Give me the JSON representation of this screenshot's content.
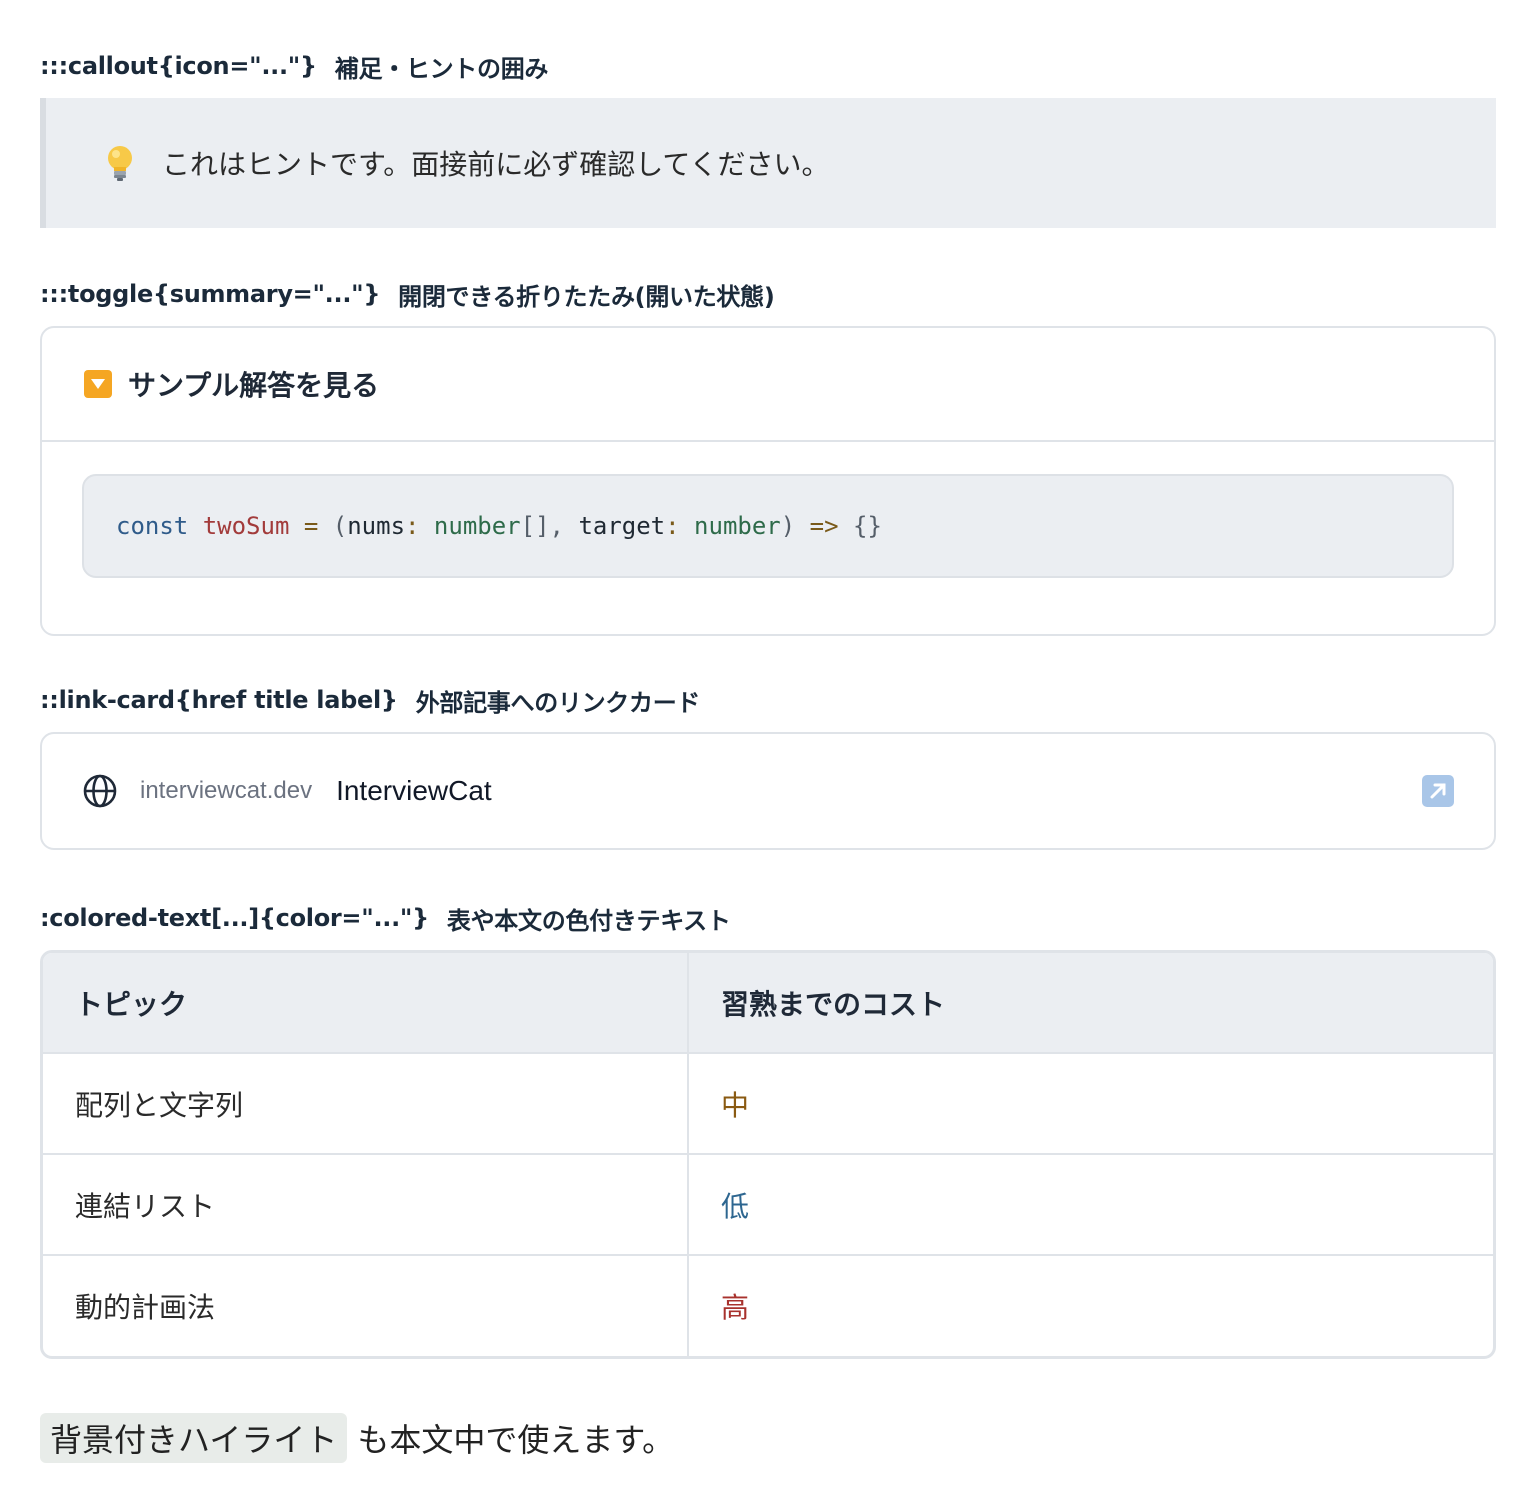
{
  "callout_section": {
    "syntax": ":::callout{icon=\"...\"}",
    "description": "補足・ヒントの囲み",
    "icon": "lightbulb-icon",
    "text": "これはヒントです。面接前に必ず確認してください。"
  },
  "toggle_section": {
    "syntax": ":::toggle{summary=\"...\"}",
    "description": "開閉できる折りたたみ(開いた状態)",
    "summary": "サンプル解答を見る",
    "state": "open",
    "code_tokens": [
      {
        "t": "const",
        "c": "tok-kw"
      },
      {
        "t": " ",
        "c": "tok-id"
      },
      {
        "t": "twoSum",
        "c": "tok-fn"
      },
      {
        "t": " ",
        "c": "tok-id"
      },
      {
        "t": "=",
        "c": "tok-op"
      },
      {
        "t": " ",
        "c": "tok-id"
      },
      {
        "t": "(",
        "c": "tok-punc"
      },
      {
        "t": "nums",
        "c": "tok-id"
      },
      {
        "t": ":",
        "c": "tok-op"
      },
      {
        "t": " ",
        "c": "tok-id"
      },
      {
        "t": "number",
        "c": "tok-type"
      },
      {
        "t": "[],",
        "c": "tok-punc"
      },
      {
        "t": " ",
        "c": "tok-id"
      },
      {
        "t": "target",
        "c": "tok-id"
      },
      {
        "t": ":",
        "c": "tok-op"
      },
      {
        "t": " ",
        "c": "tok-id"
      },
      {
        "t": "number",
        "c": "tok-type"
      },
      {
        "t": ")",
        "c": "tok-punc"
      },
      {
        "t": " ",
        "c": "tok-id"
      },
      {
        "t": "=>",
        "c": "tok-op"
      },
      {
        "t": " ",
        "c": "tok-id"
      },
      {
        "t": "{}",
        "c": "tok-punc"
      }
    ]
  },
  "link_card_section": {
    "syntax": "::link-card{href title label}",
    "description": "外部記事へのリンクカード",
    "domain": "interviewcat.dev",
    "title": "InterviewCat",
    "icon": "globe-icon",
    "external_icon": "external-link-icon"
  },
  "colored_text_section": {
    "syntax": ":colored-text[...]{color=\"...\"}",
    "description": "表や本文の色付きテキスト",
    "headers": [
      "トピック",
      "習熟までのコスト"
    ],
    "rows": [
      {
        "topic": "配列と文字列",
        "cost": "中",
        "color": "#8a5a12"
      },
      {
        "topic": "連結リスト",
        "cost": "低",
        "color": "#2d6690"
      },
      {
        "topic": "動的計画法",
        "cost": "高",
        "color": "#a8322d"
      }
    ]
  },
  "closing": {
    "highlight": "背景付きハイライト",
    "rest": "も本文中で使えます。"
  }
}
